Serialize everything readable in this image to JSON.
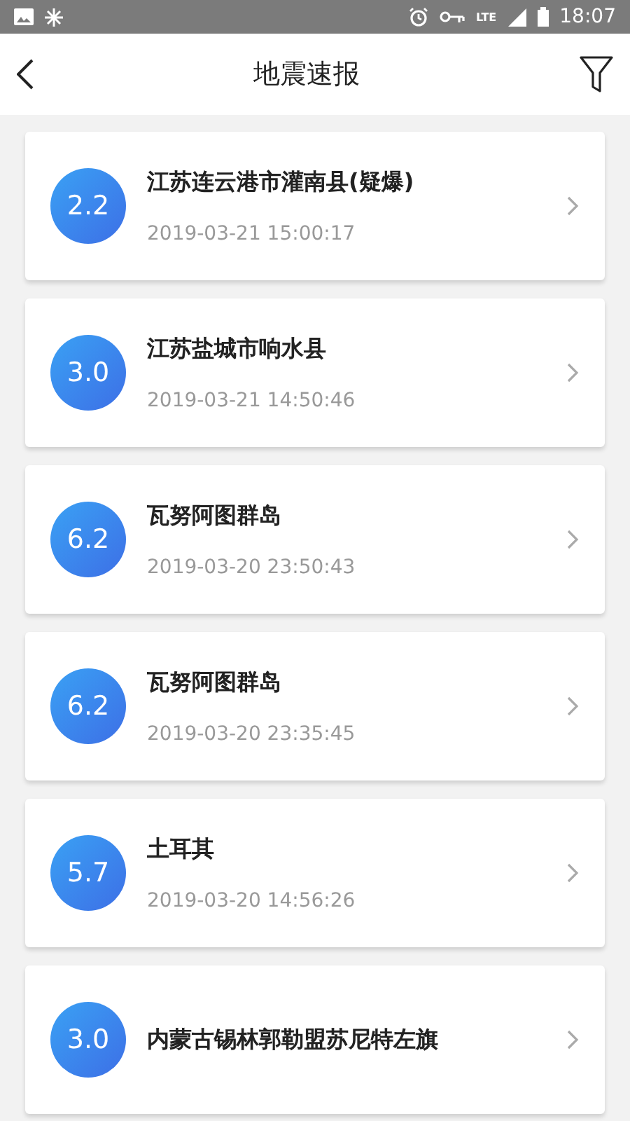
{
  "status_bar": {
    "network": "LTE",
    "time": "18:07"
  },
  "header": {
    "title": "地震速报"
  },
  "quakes": [
    {
      "magnitude": "2.2",
      "place": "江苏连云港市灌南县(疑爆)",
      "time": "2019-03-21 15:00:17"
    },
    {
      "magnitude": "3.0",
      "place": "江苏盐城市响水县",
      "time": "2019-03-21 14:50:46"
    },
    {
      "magnitude": "6.2",
      "place": "瓦努阿图群岛",
      "time": "2019-03-20 23:50:43"
    },
    {
      "magnitude": "6.2",
      "place": "瓦努阿图群岛",
      "time": "2019-03-20 23:35:45"
    },
    {
      "magnitude": "5.7",
      "place": "土耳其",
      "time": "2019-03-20 14:56:26"
    },
    {
      "magnitude": "3.0",
      "place": "内蒙古锡林郭勒盟苏尼特左旗"
    }
  ]
}
